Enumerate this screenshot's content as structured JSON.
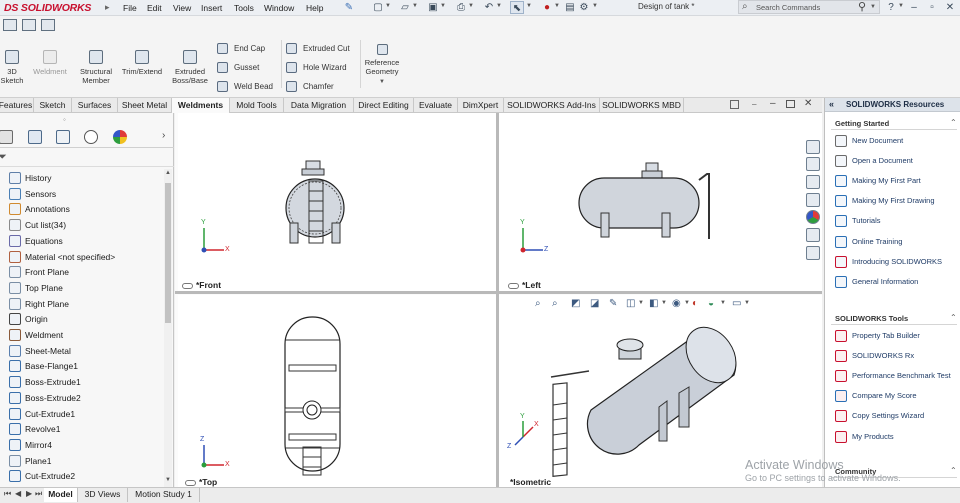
{
  "app": {
    "logo": "SOLIDWORKS",
    "logo_prefix": "DS",
    "document_title": "Design of tank *",
    "search_placeholder": "Search Commands"
  },
  "menu": [
    "File",
    "Edit",
    "View",
    "Insert",
    "Tools",
    "Window",
    "Help"
  ],
  "command_manager": {
    "large_buttons": [
      {
        "label": "3D\nSketch",
        "icon": "sketch-3d-icon",
        "enabled": true
      },
      {
        "label": "Weldment",
        "icon": "weldment-icon",
        "enabled": false
      },
      {
        "label": "Structural\nMember",
        "icon": "structural-member-icon",
        "enabled": true
      },
      {
        "label": "Trim/Extend",
        "icon": "trim-extend-icon",
        "enabled": true
      },
      {
        "label": "Extruded\nBoss/Base",
        "icon": "extruded-boss-icon",
        "enabled": true
      }
    ],
    "small_buttons_col1": [
      {
        "label": "End Cap",
        "icon": "end-cap-icon"
      },
      {
        "label": "Gusset",
        "icon": "gusset-icon"
      },
      {
        "label": "Weld Bead",
        "icon": "weld-bead-icon"
      }
    ],
    "small_buttons_col2": [
      {
        "label": "Extruded Cut",
        "icon": "extruded-cut-icon"
      },
      {
        "label": "Hole Wizard",
        "icon": "hole-wizard-icon"
      },
      {
        "label": "Chamfer",
        "icon": "chamfer-icon"
      }
    ],
    "reference_geometry": {
      "label": "Reference\nGeometry",
      "icon": "reference-geometry-icon"
    }
  },
  "tabs": [
    {
      "label": "Features",
      "active": false
    },
    {
      "label": "Sketch",
      "active": false
    },
    {
      "label": "Surfaces",
      "active": false
    },
    {
      "label": "Sheet Metal",
      "active": false
    },
    {
      "label": "Weldments",
      "active": true
    },
    {
      "label": "Mold Tools",
      "active": false
    },
    {
      "label": "Data Migration",
      "active": false
    },
    {
      "label": "Direct Editing",
      "active": false
    },
    {
      "label": "Evaluate",
      "active": false
    },
    {
      "label": "DimXpert",
      "active": false
    },
    {
      "label": "SOLIDWORKS Add-Ins",
      "active": false
    },
    {
      "label": "SOLIDWORKS MBD",
      "active": false
    }
  ],
  "feature_tree": [
    {
      "label": "History",
      "icon": "history-icon"
    },
    {
      "label": "Sensors",
      "icon": "sensors-icon"
    },
    {
      "label": "Annotations",
      "icon": "annotations-icon"
    },
    {
      "label": "Cut list(34)",
      "icon": "cut-list-icon"
    },
    {
      "label": "Equations",
      "icon": "equations-icon"
    },
    {
      "label": "Material <not specified>",
      "icon": "material-icon"
    },
    {
      "label": "Front Plane",
      "icon": "plane-icon"
    },
    {
      "label": "Top Plane",
      "icon": "plane-icon"
    },
    {
      "label": "Right Plane",
      "icon": "plane-icon"
    },
    {
      "label": "Origin",
      "icon": "origin-icon"
    },
    {
      "label": "Weldment",
      "icon": "weldment-icon"
    },
    {
      "label": "Sheet-Metal",
      "icon": "sheet-metal-icon"
    },
    {
      "label": "Base-Flange1",
      "icon": "base-flange-icon"
    },
    {
      "label": "Boss-Extrude1",
      "icon": "boss-extrude-icon"
    },
    {
      "label": "Boss-Extrude2",
      "icon": "boss-extrude-icon"
    },
    {
      "label": "Cut-Extrude1",
      "icon": "cut-extrude-icon"
    },
    {
      "label": "Revolve1",
      "icon": "revolve-icon"
    },
    {
      "label": "Mirror4",
      "icon": "mirror-icon"
    },
    {
      "label": "Plane1",
      "icon": "plane-icon"
    },
    {
      "label": "Cut-Extrude2",
      "icon": "cut-extrude-icon"
    }
  ],
  "viewports": {
    "front": "*Front",
    "left": "*Left",
    "top": "*Top",
    "isometric": "*Isometric",
    "axis_x": "X",
    "axis_y": "Y",
    "axis_z": "Z"
  },
  "task_pane": {
    "title": "SOLIDWORKS Resources",
    "getting_started": {
      "title": "Getting Started",
      "items": [
        "New Document",
        "Open a Document",
        "Making My First Part",
        "Making My First Drawing",
        "Tutorials",
        "Online Training",
        "Introducing SOLIDWORKS",
        "General Information"
      ]
    },
    "tools": {
      "title": "SOLIDWORKS Tools",
      "items": [
        "Property Tab Builder",
        "SOLIDWORKS Rx",
        "Performance Benchmark Test",
        "Compare My Score",
        "Copy Settings Wizard",
        "My Products"
      ]
    },
    "community": {
      "title": "Community"
    }
  },
  "bottom_tabs": [
    {
      "label": "Model",
      "active": true
    },
    {
      "label": "3D Views",
      "active": false
    },
    {
      "label": "Motion Study 1",
      "active": false
    }
  ],
  "watermark": {
    "line1": "Activate Windows",
    "line2": "Go to PC settings to activate Windows."
  },
  "colors": {
    "brand": "#c8102e",
    "accent": "#1f3b66",
    "tank_fill": "#cfd5de",
    "axis_x": "#d0262e",
    "axis_y": "#2a9d3a",
    "axis_z": "#2f4fb5"
  }
}
